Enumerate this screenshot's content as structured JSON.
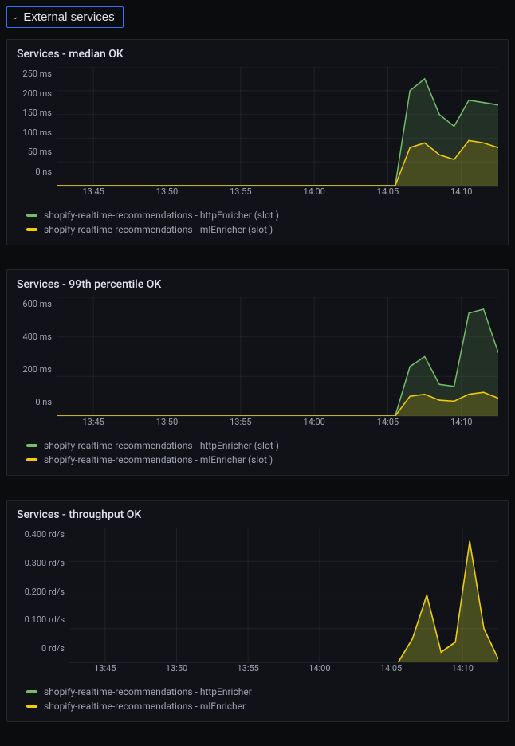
{
  "section": {
    "title": "External services"
  },
  "panels": [
    {
      "id": "median",
      "title": "Services - median OK",
      "y_ticks": [
        "250 ms",
        "200 ms",
        "150 ms",
        "100 ms",
        "50 ms",
        "0 ns"
      ],
      "x_ticks": [
        "13:45",
        "13:50",
        "13:55",
        "14:00",
        "14:05",
        "14:10"
      ],
      "legend": [
        "shopify-realtime-recommendations - httpEnricher (slot )",
        "shopify-realtime-recommendations - mlEnricher (slot )"
      ]
    },
    {
      "id": "p99",
      "title": "Services - 99th percentile OK",
      "y_ticks": [
        "600 ms",
        "400 ms",
        "200 ms",
        "0 ns"
      ],
      "x_ticks": [
        "13:45",
        "13:50",
        "13:55",
        "14:00",
        "14:05",
        "14:10"
      ],
      "legend": [
        "shopify-realtime-recommendations - httpEnricher (slot )",
        "shopify-realtime-recommendations - mlEnricher (slot )"
      ]
    },
    {
      "id": "throughput",
      "title": "Services - throughput OK",
      "y_ticks": [
        "0.400 rd/s",
        "0.300 rd/s",
        "0.200 rd/s",
        "0.100 rd/s",
        "0 rd/s"
      ],
      "x_ticks": [
        "13:45",
        "13:50",
        "13:55",
        "14:00",
        "14:05",
        "14:10"
      ],
      "legend": [
        "shopify-realtime-recommendations - httpEnricher",
        "shopify-realtime-recommendations - mlEnricher"
      ]
    }
  ],
  "chart_data": [
    {
      "type": "area",
      "title": "Services - median OK",
      "xlabel": "",
      "ylabel": "",
      "ylim": [
        0,
        250
      ],
      "x_unit": "time (HH:MM)",
      "y_unit": "ms",
      "x": [
        "13:42",
        "13:45",
        "13:50",
        "13:55",
        "14:00",
        "14:05",
        "14:06",
        "14:07",
        "14:08",
        "14:09",
        "14:10",
        "14:11",
        "14:12"
      ],
      "series": [
        {
          "name": "shopify-realtime-recommendations - httpEnricher (slot )",
          "color": "#73bf69",
          "values": [
            0,
            0,
            0,
            0,
            0,
            0,
            200,
            225,
            150,
            125,
            180,
            175,
            170
          ]
        },
        {
          "name": "shopify-realtime-recommendations - mlEnricher (slot )",
          "color": "#f2cc0c",
          "values": [
            0,
            0,
            0,
            0,
            0,
            0,
            80,
            90,
            65,
            55,
            95,
            90,
            80
          ]
        }
      ]
    },
    {
      "type": "area",
      "title": "Services - 99th percentile OK",
      "xlabel": "",
      "ylabel": "",
      "ylim": [
        0,
        600
      ],
      "x_unit": "time (HH:MM)",
      "y_unit": "ms",
      "x": [
        "13:42",
        "13:45",
        "13:50",
        "13:55",
        "14:00",
        "14:05",
        "14:06",
        "14:07",
        "14:08",
        "14:09",
        "14:10",
        "14:11",
        "14:12"
      ],
      "series": [
        {
          "name": "shopify-realtime-recommendations - httpEnricher (slot )",
          "color": "#73bf69",
          "values": [
            0,
            0,
            0,
            0,
            0,
            0,
            250,
            300,
            160,
            150,
            520,
            540,
            320
          ]
        },
        {
          "name": "shopify-realtime-recommendations - mlEnricher (slot )",
          "color": "#f2cc0c",
          "values": [
            0,
            0,
            0,
            0,
            0,
            0,
            100,
            110,
            80,
            75,
            110,
            120,
            90
          ]
        }
      ]
    },
    {
      "type": "area",
      "title": "Services - throughput OK",
      "xlabel": "",
      "ylabel": "",
      "ylim": [
        0,
        0.4
      ],
      "x_unit": "time (HH:MM)",
      "y_unit": "rd/s",
      "x": [
        "13:42",
        "13:45",
        "13:50",
        "13:55",
        "14:00",
        "14:05",
        "14:06",
        "14:07",
        "14:08",
        "14:09",
        "14:10",
        "14:11",
        "14:12"
      ],
      "series": [
        {
          "name": "shopify-realtime-recommendations - httpEnricher",
          "color": "#73bf69",
          "values": [
            0,
            0,
            0,
            0,
            0,
            0,
            0.07,
            0.2,
            0.03,
            0.06,
            0.36,
            0.1,
            0.01
          ]
        },
        {
          "name": "shopify-realtime-recommendations - mlEnricher",
          "color": "#f2cc0c",
          "values": [
            0,
            0,
            0,
            0,
            0,
            0,
            0.07,
            0.2,
            0.03,
            0.06,
            0.36,
            0.1,
            0.01
          ]
        }
      ]
    }
  ]
}
